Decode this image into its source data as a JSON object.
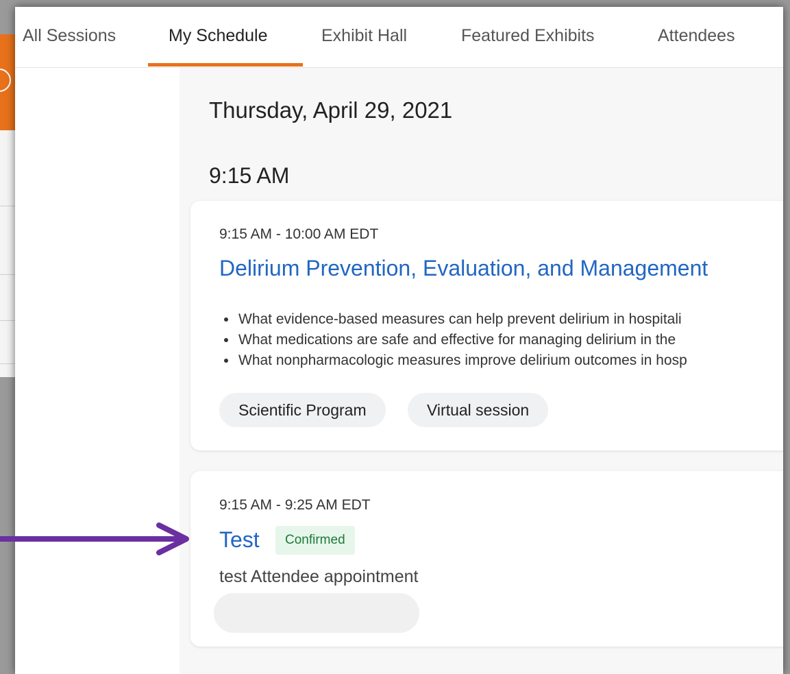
{
  "tabs": [
    {
      "label": "All Sessions"
    },
    {
      "label": "My Schedule"
    },
    {
      "label": "Exhibit Hall"
    },
    {
      "label": "Featured Exhibits"
    },
    {
      "label": "Attendees"
    }
  ],
  "schedule": {
    "date": "Thursday, April 29, 2021",
    "time_group": "9:15 AM",
    "sessions": [
      {
        "time": "9:15 AM - 10:00 AM EDT",
        "title": "Delirium Prevention, Evaluation, and Management",
        "bullets": [
          "What evidence-based measures can help prevent delirium in hospitali",
          "What medications are safe and effective for managing delirium in the",
          "What nonpharmacologic measures improve delirium outcomes in hosp"
        ],
        "tags": [
          "Scientific Program",
          "Virtual session"
        ]
      },
      {
        "time": "9:15 AM - 9:25 AM EDT",
        "title": "Test",
        "badge": "Confirmed",
        "description": "test Attendee appointment"
      }
    ]
  },
  "colors": {
    "accent": "#e8711b",
    "link": "#2166c2",
    "confirmed_bg": "#e6f6ea",
    "confirmed_text": "#1f7a3a",
    "arrow": "#6a2fa0"
  }
}
